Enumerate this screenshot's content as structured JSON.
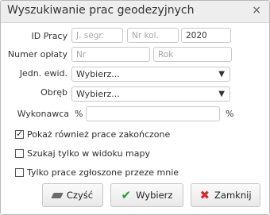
{
  "dialog": {
    "title": "Wyszukiwanie prac geodezyjnych",
    "close_glyph": "×"
  },
  "form": {
    "id_pracy": {
      "label": "ID Pracy",
      "seg_placeholder": "J. segr.",
      "kol_placeholder": "Nr kol.",
      "year_value": "2020"
    },
    "numer_oplaty": {
      "label": "Numer opłaty",
      "nr_placeholder": "Nr",
      "rok_placeholder": "Rok"
    },
    "jedn_ewid": {
      "label": "Jedn. ewid.",
      "selected": "Wybierz..."
    },
    "obreb": {
      "label": "Obręb",
      "selected": "Wybierz..."
    },
    "wykonawca": {
      "label": "Wykonawca",
      "prefix": "%",
      "suffix": "%",
      "value": ""
    }
  },
  "options": [
    {
      "label": "Pokaż również prace zakończone",
      "checked": true
    },
    {
      "label": "Szukaj tylko w widoku mapy",
      "checked": false
    },
    {
      "label": "Tylko prace zgłoszone przeze mnie",
      "checked": false
    }
  ],
  "buttons": {
    "clear": "Czyść",
    "select": "Wybierz",
    "close": "Zamknij"
  },
  "icons": {
    "clear": "eraser-icon",
    "select": "check-icon",
    "close": "x-icon",
    "dropdown": "caret-down-icon"
  },
  "colors": {
    "check": "#2e9a2e",
    "close": "#d62a2a"
  }
}
